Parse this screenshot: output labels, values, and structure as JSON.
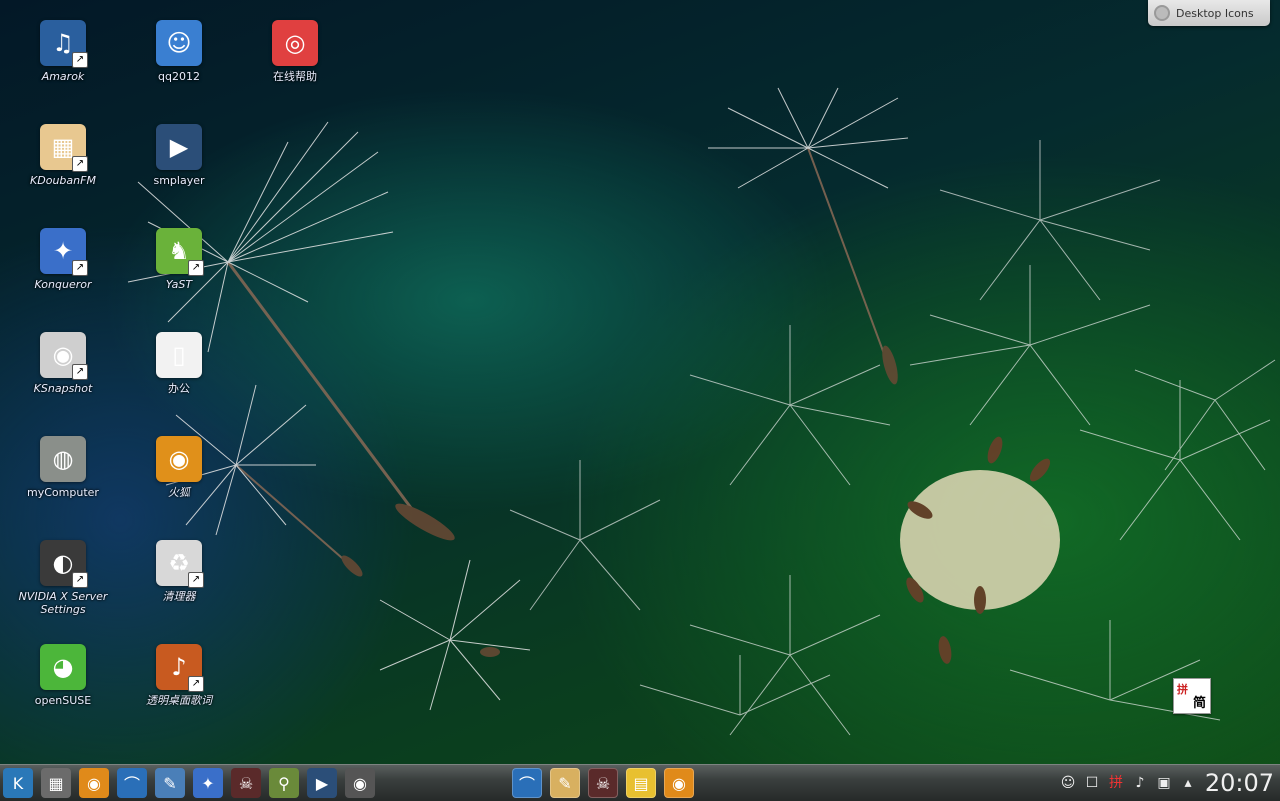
{
  "desktop": {
    "icons": [
      {
        "label": "Amarok",
        "italic": true,
        "icon": "amarok-icon",
        "bg": "#2a5f9e",
        "glyph": "♫",
        "shortcut": true
      },
      {
        "label": "qq2012",
        "italic": false,
        "icon": "qq-icon",
        "bg": "#3a7fd1",
        "glyph": "☺",
        "shortcut": false
      },
      {
        "label": "在线帮助",
        "italic": false,
        "icon": "help-lifebuoy-icon",
        "bg": "#e04040",
        "glyph": "◎",
        "shortcut": false
      },
      {
        "label": "KDoubanFM",
        "italic": true,
        "icon": "radio-icon",
        "bg": "#e8c890",
        "glyph": "▦",
        "shortcut": true
      },
      {
        "label": "smplayer",
        "italic": false,
        "icon": "smplayer-icon",
        "bg": "#2b4e78",
        "glyph": "▶",
        "shortcut": false
      },
      {
        "label": "Konqueror",
        "italic": true,
        "icon": "konqueror-icon",
        "bg": "#3a6fc9",
        "glyph": "✦",
        "shortcut": true
      },
      {
        "label": "YaST",
        "italic": true,
        "icon": "yast-icon",
        "bg": "#6ab23a",
        "glyph": "♞",
        "shortcut": true
      },
      {
        "label": "KSnapshot",
        "italic": true,
        "icon": "camera-icon",
        "bg": "#cfcfcf",
        "glyph": "◉",
        "shortcut": true
      },
      {
        "label": "办公",
        "italic": false,
        "icon": "document-icon",
        "bg": "#f2f2f2",
        "glyph": "▯",
        "shortcut": false
      },
      {
        "label": "myComputer",
        "italic": false,
        "icon": "computer-icon",
        "bg": "#8a8f8a",
        "glyph": "◍",
        "shortcut": false
      },
      {
        "label": "火狐",
        "italic": true,
        "icon": "firefox-eye-icon",
        "bg": "#e0901a",
        "glyph": "◉",
        "shortcut": false
      },
      {
        "label": "NVIDIA X Server Settings",
        "italic": true,
        "icon": "nvidia-icon",
        "bg": "#3a3a3a",
        "glyph": "◐",
        "shortcut": true
      },
      {
        "label": "清理器",
        "italic": true,
        "icon": "trash-cleaner-icon",
        "bg": "#d8d8d8",
        "glyph": "♻",
        "shortcut": true
      },
      {
        "label": "openSUSE",
        "italic": false,
        "icon": "opensuse-icon",
        "bg": "#4cb63a",
        "glyph": "◕",
        "shortcut": false
      },
      {
        "label": "透明桌面歌词",
        "italic": true,
        "icon": "lyrics-icon",
        "bg": "#c85a20",
        "glyph": "♪",
        "shortcut": true
      }
    ],
    "widget_button": "Desktop Icons",
    "ime_badge": {
      "top": "拼",
      "bottom": "简"
    }
  },
  "taskbar": {
    "launchers": [
      {
        "name": "kde-menu-icon",
        "glyph": "K",
        "bg": "#2a78b8"
      },
      {
        "name": "system-settings-icon",
        "glyph": "▦",
        "bg": "#6b6b6b"
      },
      {
        "name": "firefox-eye-icon",
        "glyph": "◉",
        "bg": "#e08a1a"
      },
      {
        "name": "dolphin-icon",
        "glyph": "⌒",
        "bg": "#2a6fb8"
      },
      {
        "name": "tools-icon",
        "glyph": "✎",
        "bg": "#4a7fb8"
      },
      {
        "name": "konqueror-icon",
        "glyph": "✦",
        "bg": "#3a6fc9"
      },
      {
        "name": "skull-icon",
        "glyph": "☠",
        "bg": "#5a2a2a"
      },
      {
        "name": "search-magnifier-icon",
        "glyph": "⚲",
        "bg": "#6a8a3a"
      },
      {
        "name": "video-icon",
        "glyph": "▶",
        "bg": "#2b4e78"
      },
      {
        "name": "camera-icon",
        "glyph": "◉",
        "bg": "#555"
      }
    ],
    "tasks": [
      {
        "name": "dolphin-task-icon",
        "glyph": "⌒",
        "bg": "#2a6fb8"
      },
      {
        "name": "notes-task-icon",
        "glyph": "✎",
        "bg": "#d8b060"
      },
      {
        "name": "skull-task-icon",
        "glyph": "☠",
        "bg": "#5a2a2a"
      },
      {
        "name": "sticky-note-task-icon",
        "glyph": "▤",
        "bg": "#e8c030"
      },
      {
        "name": "firefox-task-icon",
        "glyph": "◉",
        "bg": "#e08a1a"
      }
    ],
    "tray": [
      {
        "name": "qq-tray-icon",
        "glyph": "☺"
      },
      {
        "name": "dictionary-tray-icon",
        "glyph": "☐"
      },
      {
        "name": "input-method-tray-icon",
        "glyph": "拼"
      },
      {
        "name": "volume-tray-icon",
        "glyph": "♪"
      },
      {
        "name": "device-tray-icon",
        "glyph": "▣"
      },
      {
        "name": "expand-tray-icon",
        "glyph": "▴"
      }
    ],
    "clock": "20:07"
  }
}
